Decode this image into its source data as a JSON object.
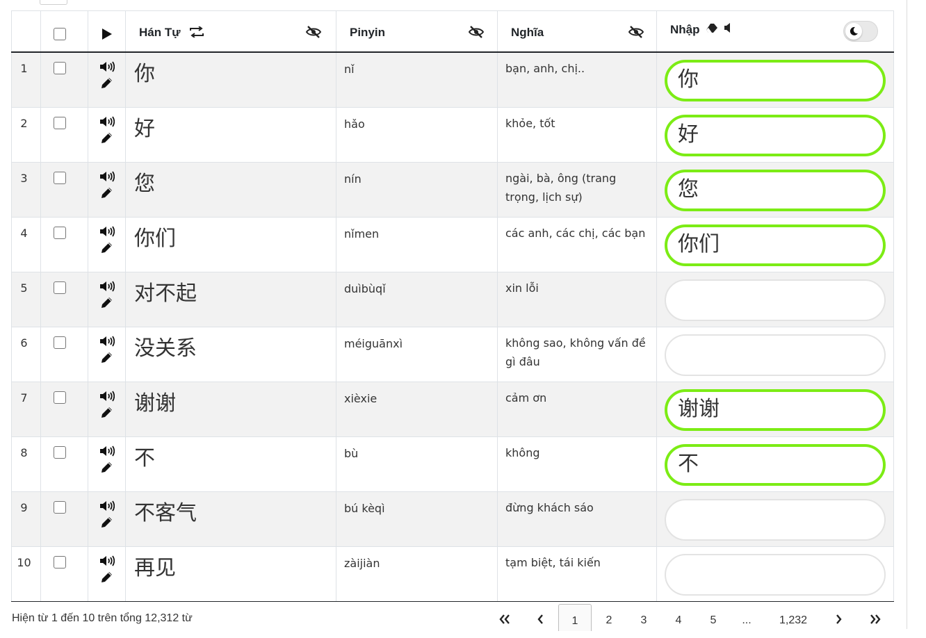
{
  "header": {
    "han_label": "Hán Tự",
    "pinyin_label": "Pinyin",
    "meaning_label": "Nghĩa",
    "input_label": "Nhập"
  },
  "rows": [
    {
      "index": "1",
      "han": "你",
      "pinyin": "nǐ",
      "meaning": "bạn, anh, chị..",
      "answer": "你",
      "correct": true
    },
    {
      "index": "2",
      "han": "好",
      "pinyin": "hǎo",
      "meaning": "khỏe, tốt",
      "answer": "好",
      "correct": true
    },
    {
      "index": "3",
      "han": "您",
      "pinyin": "nín",
      "meaning": "ngài, bà, ông (trang trọng, lịch sự)",
      "answer": "您",
      "correct": true
    },
    {
      "index": "4",
      "han": "你们",
      "pinyin": "nǐmen",
      "meaning": "các anh, các chị, các bạn",
      "answer": "你们",
      "correct": true
    },
    {
      "index": "5",
      "han": "对不起",
      "pinyin": "duìbùqǐ",
      "meaning": "xin lỗi",
      "answer": "",
      "correct": false
    },
    {
      "index": "6",
      "han": "没关系",
      "pinyin": "méiguānxì",
      "meaning": "không sao, không vấn đề gì đâu",
      "answer": "",
      "correct": false
    },
    {
      "index": "7",
      "han": "谢谢",
      "pinyin": "xièxie",
      "meaning": "cảm ơn",
      "answer": "谢谢",
      "correct": true
    },
    {
      "index": "8",
      "han": "不",
      "pinyin": "bù",
      "meaning": "không",
      "answer": "不",
      "correct": true
    },
    {
      "index": "9",
      "han": "不客气",
      "pinyin": "bú kèqì",
      "meaning": "đừng khách sáo",
      "answer": "",
      "correct": false
    },
    {
      "index": "10",
      "han": "再见",
      "pinyin": "zàijiàn",
      "meaning": "tạm biệt, tái kiến",
      "answer": "",
      "correct": false
    }
  ],
  "footer": {
    "summary": "Hiện từ 1 đến 10 trên tổng 12,312 từ"
  },
  "pagination": {
    "first": "«",
    "prev": "‹",
    "pages": [
      "1",
      "2",
      "3",
      "4",
      "5"
    ],
    "ellipsis": "...",
    "last_page": "1,232",
    "next": "›",
    "last": "»",
    "active_page": "1"
  },
  "icons": {
    "play": "play-icon",
    "swap": "swap-icon",
    "hide": "eye-slash-icon",
    "eraser": "eraser-icon",
    "volume": "volume-icon",
    "edit": "pencil-icon",
    "dark_mode": "moon-icon"
  },
  "colors": {
    "correct_border": "#7cec15",
    "row_stripe": "#f2f2f2"
  }
}
